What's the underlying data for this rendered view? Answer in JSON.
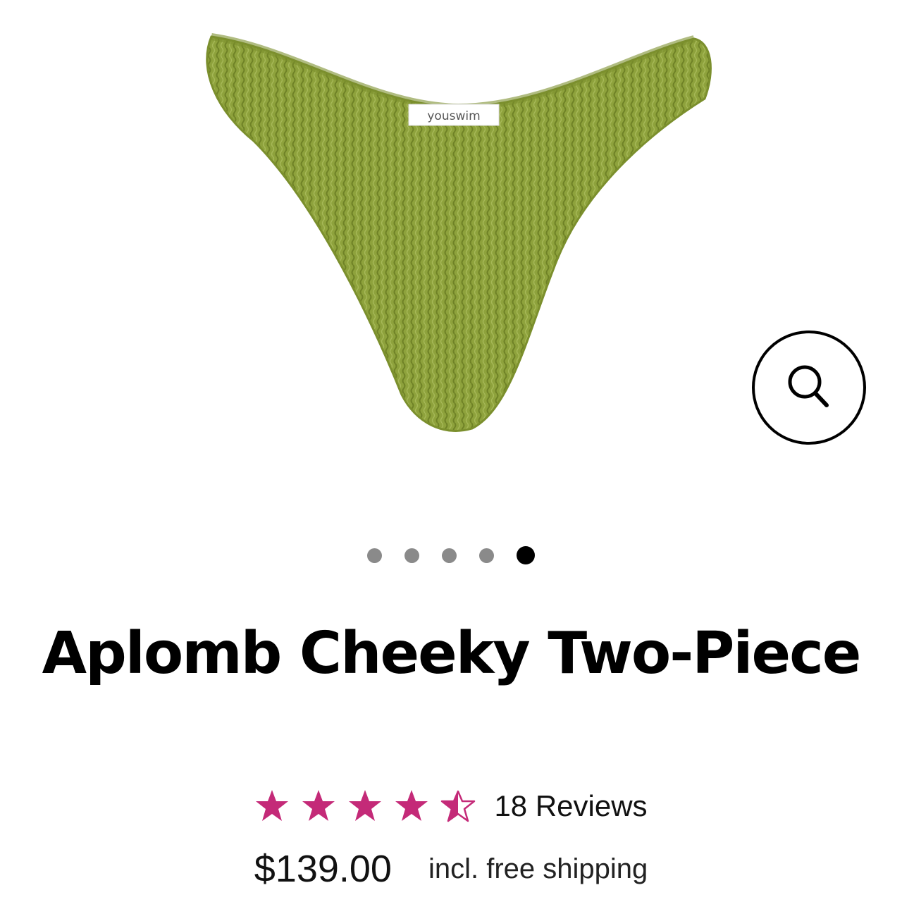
{
  "product": {
    "brand_label": "youswim",
    "title": "Aplomb Cheeky Two-Piece",
    "rating": 4.5,
    "rating_max": 5,
    "reviews_label": "18 Reviews",
    "price": "$139.00",
    "shipping_note": "incl. free shipping"
  },
  "gallery": {
    "total_images": 5,
    "active_index": 4,
    "zoom_icon": "search-icon"
  },
  "colors": {
    "star": "#c42a78",
    "garment": "#8ea23c",
    "dot_inactive": "#8a8a8a",
    "dot_active": "#000000"
  }
}
